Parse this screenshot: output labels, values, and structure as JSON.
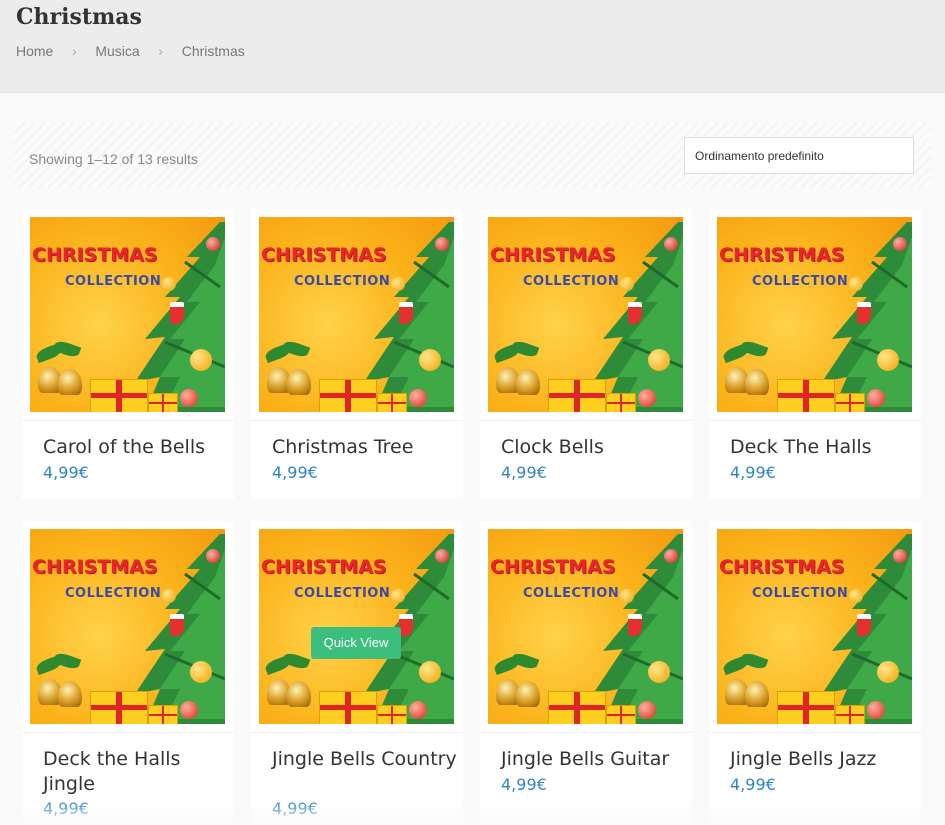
{
  "page": {
    "title": "Christmas",
    "breadcrumb": [
      "Home",
      "Musica",
      "Christmas"
    ]
  },
  "toolbar": {
    "results": "Showing 1–12 of 13 results",
    "sort_selected": "Ordinamento predefinito"
  },
  "thumb": {
    "title": "CHRISTMAS",
    "subtitle": "COLLECTION"
  },
  "quick_view_label": "Quick View",
  "products": [
    {
      "name": "Carol of the Bells",
      "price": "4,99€"
    },
    {
      "name": "Christmas Tree",
      "price": "4,99€"
    },
    {
      "name": "Clock Bells",
      "price": "4,99€"
    },
    {
      "name": "Deck The Halls",
      "price": "4,99€"
    },
    {
      "name": "Deck the Halls Jingle",
      "price": "4,99€"
    },
    {
      "name": "Jingle Bells Country",
      "price": "4,99€"
    },
    {
      "name": "Jingle Bells Guitar",
      "price": "4,99€"
    },
    {
      "name": "Jingle Bells Jazz",
      "price": "4,99€"
    }
  ],
  "colors": {
    "accent_price": "#2e86c1",
    "quick_view": "#3cbf7d",
    "header_bg": "#ececec"
  }
}
